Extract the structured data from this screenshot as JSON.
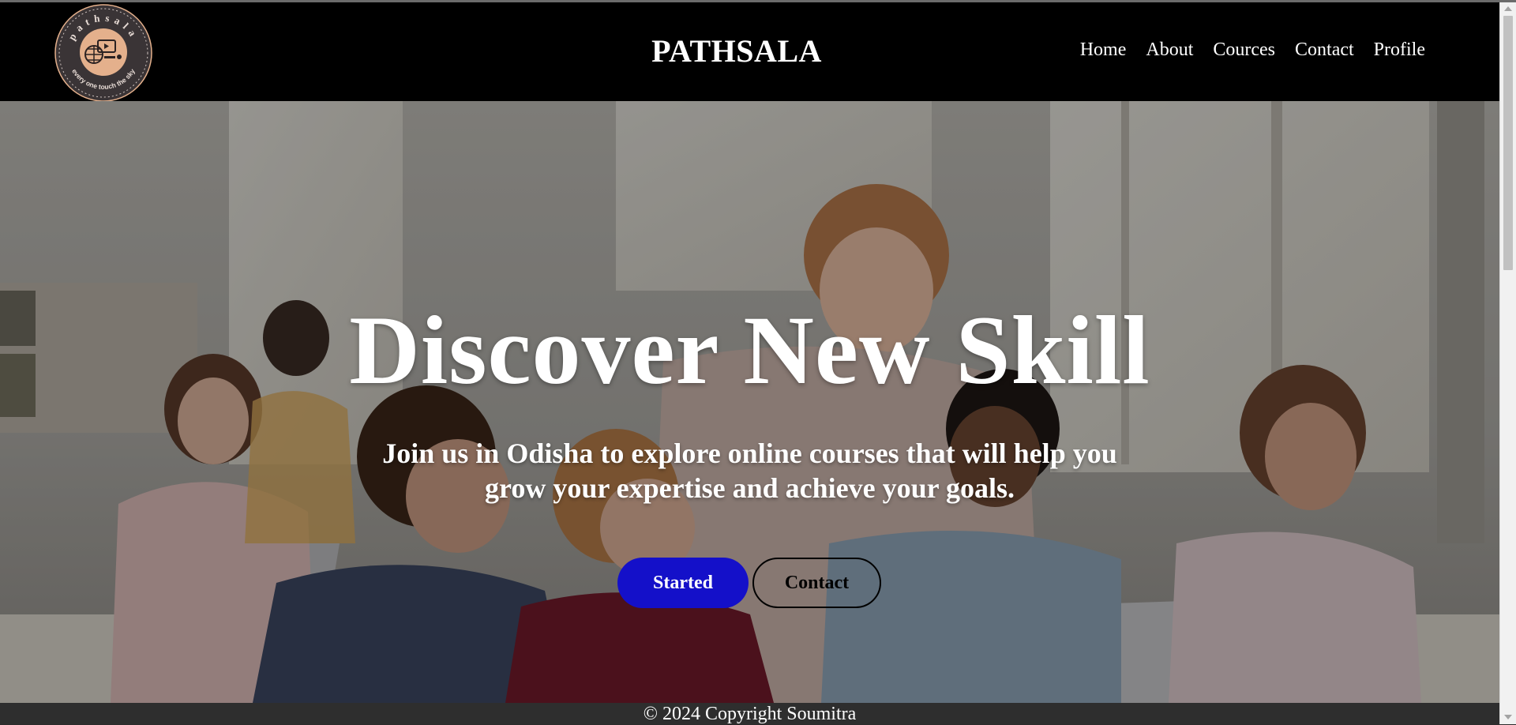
{
  "header": {
    "logo_text_top": "pathsala",
    "logo_text_bottom": "every one touch the sky",
    "brand": "PATHSALA",
    "nav": [
      {
        "label": "Home"
      },
      {
        "label": "About"
      },
      {
        "label": "Cources"
      },
      {
        "label": "Contact"
      },
      {
        "label": "Profile"
      }
    ]
  },
  "hero": {
    "title": "Discover New Skill",
    "subtitle": "Join us in Odisha to explore online courses that will help you grow your expertise and achieve your goals.",
    "primary_button": "Started",
    "secondary_button": "Contact"
  },
  "footer": {
    "copyright": "© 2024 Copyright Soumitra"
  },
  "colors": {
    "navbar_bg": "#000000",
    "primary_button": "#1410c9",
    "logo_ring": "#3a3436",
    "logo_center": "#e4b08c"
  }
}
